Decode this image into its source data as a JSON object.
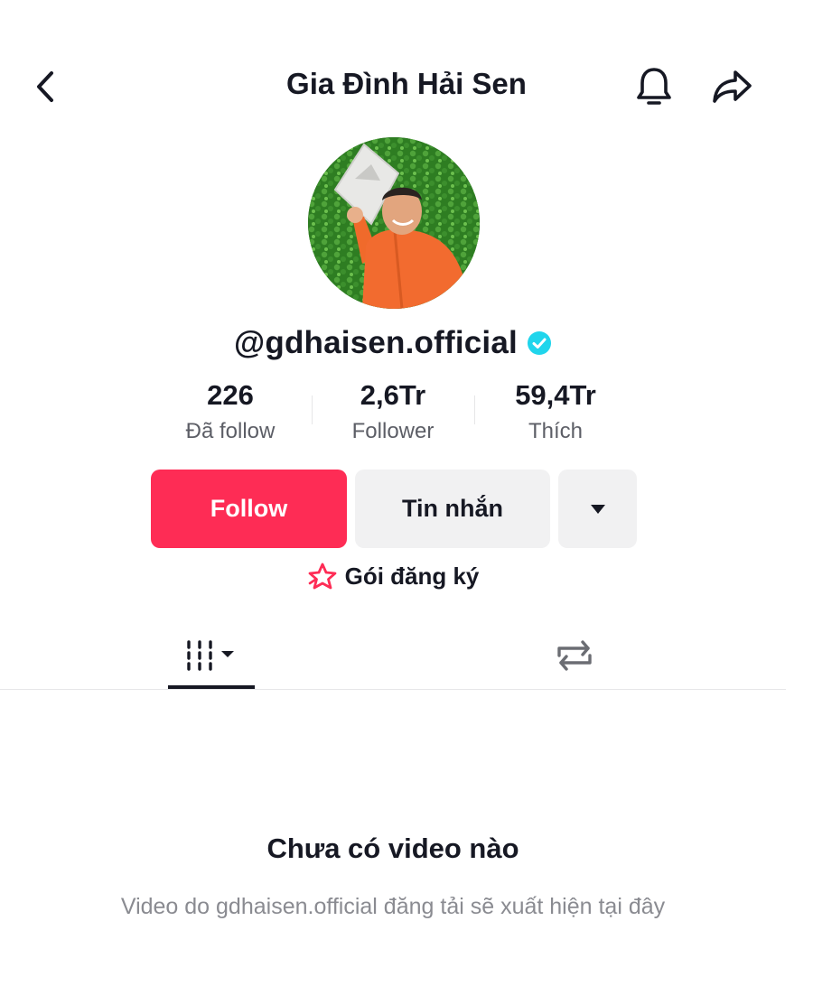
{
  "header": {
    "title": "Gia Đình Hải Sen"
  },
  "profile": {
    "username": "@gdhaisen.official",
    "verified": true
  },
  "stats": [
    {
      "value": "226",
      "label": "Đã follow"
    },
    {
      "value": "2,6Tr",
      "label": "Follower"
    },
    {
      "value": "59,4Tr",
      "label": "Thích"
    }
  ],
  "actions": {
    "follow_label": "Follow",
    "message_label": "Tin nhắn"
  },
  "subscription": {
    "label": "Gói đăng ký"
  },
  "tabs": [
    {
      "name": "videos",
      "icon": "grid-icon",
      "selected": true
    },
    {
      "name": "reposts",
      "icon": "repost-icon",
      "selected": false
    }
  ],
  "empty_state": {
    "title": "Chưa có video nào",
    "description": "Video do gdhaisen.official đăng tải sẽ xuất hiện tại đây"
  },
  "colors": {
    "accent": "#fe2c55",
    "verified": "#20d5ec",
    "text": "#161823",
    "muted": "#8a8b91",
    "button_bg": "#f1f1f2"
  }
}
